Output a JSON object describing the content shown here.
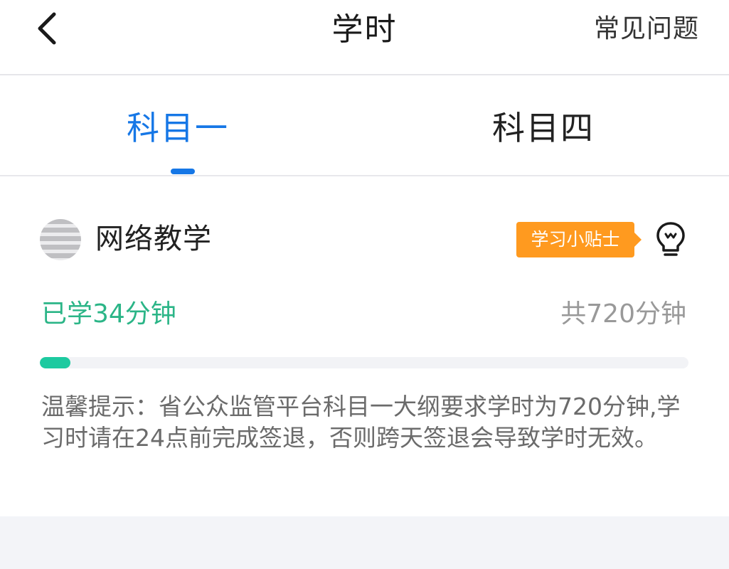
{
  "header": {
    "back_icon": "chevron-left-icon",
    "title": "学时",
    "faq_label": "常见问题"
  },
  "tabs": [
    {
      "label": "科目一",
      "active": true
    },
    {
      "label": "科目四",
      "active": false
    }
  ],
  "course": {
    "icon": "course-avatar-icon",
    "name": "网络教学",
    "tips_label": "学习小贴士",
    "bulb_icon": "lightbulb-icon"
  },
  "progress": {
    "studied_text": "已学34分钟",
    "total_text": "共720分钟",
    "studied_minutes": 34,
    "total_minutes": 720
  },
  "notice": {
    "text": "温馨提示：省公众监管平台科目一大纲要求学时为720分钟,学习时请在24点前完成签退，否则跨天签退会导致学时无效。"
  },
  "colors": {
    "accent": "#1677e6",
    "studied": "#2bb587",
    "progress_fill": "#1dcaa0",
    "badge": "#ff9a1f"
  }
}
